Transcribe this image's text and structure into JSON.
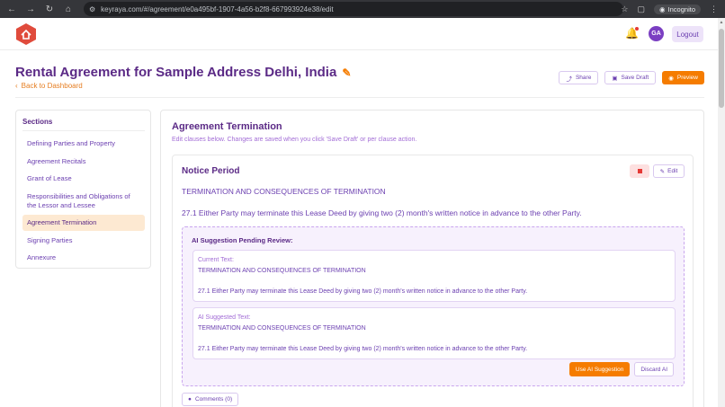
{
  "browser": {
    "url": "keyraya.com/#/agreement/e0a495bf-1907-4a56-b2f8-667993924e38/edit",
    "incognito_label": "Incognito"
  },
  "header": {
    "avatar_initials": "GA",
    "logout_label": "Logout"
  },
  "page": {
    "title": "Rental Agreement for Sample Address Delhi, India",
    "back_label": "Back to Dashboard",
    "share_label": "Share",
    "save_draft_label": "Save Draft",
    "preview_label": "Preview"
  },
  "sidebar": {
    "heading": "Sections",
    "items": [
      {
        "label": "Defining Parties and Property"
      },
      {
        "label": "Agreement Recitals"
      },
      {
        "label": "Grant of Lease"
      },
      {
        "label": "Responsibilities and Obligations of the Lessor and Lessee"
      },
      {
        "label": "Agreement Termination"
      },
      {
        "label": "Signing Parties"
      },
      {
        "label": "Annexure"
      }
    ]
  },
  "main": {
    "title": "Agreement Termination",
    "subtitle": "Edit clauses below. Changes are saved when you click 'Save Draft' or per clause action.",
    "clause": {
      "title": "Notice Period",
      "edit_label": "Edit",
      "heading_text": "TERMINATION AND CONSEQUENCES OF TERMINATION",
      "body_text": "27.1 Either Party may terminate this Lease Deed by giving two (2) month's written notice in advance to the other Party.",
      "ai": {
        "title": "AI Suggestion Pending Review:",
        "current_label": "Current Text:",
        "current_heading": "TERMINATION AND CONSEQUENCES OF TERMINATION",
        "current_body": "27.1 Either Party may terminate this Lease Deed by giving two (2) month's written notice in advance to the other Party.",
        "suggested_label": "AI Suggested Text:",
        "suggested_heading": "TERMINATION AND CONSEQUENCES OF TERMINATION",
        "suggested_body": "27.1 Either Party may terminate this Lease Deed by giving two (2) month's written notice in advance to the other Party.",
        "use_label": "Use AI Suggestion",
        "discard_label": "Discard AI"
      },
      "comments_label": "Comments (0)"
    }
  },
  "colors": {
    "brand_purple": "#5b2a86",
    "accent_orange": "#f57c00",
    "logo_red": "#e04b3c"
  }
}
